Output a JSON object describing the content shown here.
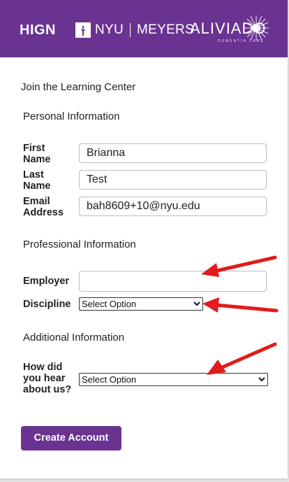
{
  "header": {
    "logo_higin": "HIGN",
    "logo_nyu": "NYU",
    "logo_meyers": "MEYERS",
    "logo_aliviado": "ALIVIADO",
    "logo_aliviado_sub": "DEMENTIA CARE",
    "background": "#6a3392"
  },
  "page": {
    "title": "Join the Learning Center"
  },
  "personal": {
    "section_title": "Personal Information",
    "first_name_label_1": "First",
    "first_name_label_2": "Name",
    "first_name_value": "Brianna",
    "last_name_label_1": "Last",
    "last_name_label_2": "Name",
    "last_name_value": "Test",
    "email_label_1": "Email",
    "email_label_2": "Address",
    "email_value": "bah8609+10@nyu.edu"
  },
  "professional": {
    "section_title": "Professional Information",
    "employer_label": "Employer",
    "employer_value": "",
    "discipline_label": "Discipline",
    "discipline_selected": "Select Option"
  },
  "additional": {
    "section_title": "Additional Information",
    "hear_label_1": "How did",
    "hear_label_2": "you hear",
    "hear_label_3": "about us?",
    "hear_selected": "Select Option"
  },
  "actions": {
    "create_account": "Create Account"
  },
  "annotations": {
    "arrow_color": "#e31b1b"
  },
  "icons": {
    "dropdown": "chevron-down-icon",
    "nyu_torch": "torch-icon",
    "aliviado_burst": "starburst-icon"
  }
}
